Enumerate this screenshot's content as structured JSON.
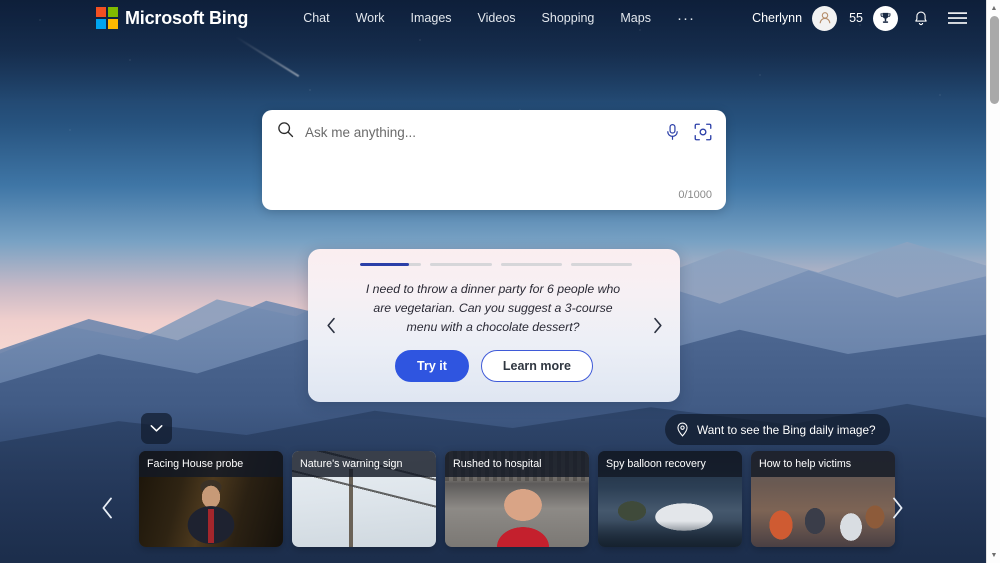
{
  "header": {
    "brand": "Microsoft Bing",
    "logo_icon": "microsoft-squares-icon",
    "nav": [
      {
        "label": "Chat"
      },
      {
        "label": "Work"
      },
      {
        "label": "Images"
      },
      {
        "label": "Videos"
      },
      {
        "label": "Shopping"
      },
      {
        "label": "Maps"
      }
    ],
    "more_label": "···",
    "user_name": "Cherlynn",
    "avatar_icon": "person-avatar-icon",
    "rewards_count": "55",
    "rewards_icon": "trophy-icon",
    "notifications_icon": "bell-icon",
    "menu_icon": "hamburger-menu-icon"
  },
  "search": {
    "placeholder": "Ask me anything...",
    "value": "",
    "search_icon": "search-icon",
    "mic_icon": "microphone-icon",
    "camera_icon": "visual-search-camera-icon",
    "char_count": "0/1000"
  },
  "suggestion": {
    "progress": [
      80,
      0,
      0,
      0
    ],
    "prompt": "I need to throw a dinner party for 6 people who are vegetarian. Can you suggest a 3-course menu with a chocolate dessert?",
    "try_label": "Try it",
    "learn_label": "Learn more",
    "prev_icon": "chevron-left-icon",
    "next_icon": "chevron-right-icon",
    "accent_color": "#2f55e0",
    "progress_fill_color": "#2b3fa8"
  },
  "daily_image": {
    "label": "Want to see the Bing daily image?",
    "pin_icon": "location-pin-icon"
  },
  "collapse": {
    "icon": "chevron-down-icon"
  },
  "news": {
    "prev_icon": "chevron-left-icon",
    "next_icon": "chevron-right-icon",
    "cards": [
      {
        "title": "Facing House probe",
        "art": "img-hearing"
      },
      {
        "title": "Nature's warning sign",
        "art": "img-birds"
      },
      {
        "title": "Rushed to hospital",
        "art": "img-stadium"
      },
      {
        "title": "Spy balloon recovery",
        "art": "img-balloon"
      },
      {
        "title": "How to help victims",
        "art": "img-crowd"
      }
    ]
  },
  "scrollbar": {
    "up_icon": "scroll-up-arrow-icon",
    "down_icon": "scroll-down-arrow-icon",
    "up_glyph": "▲",
    "down_glyph": "▼"
  }
}
